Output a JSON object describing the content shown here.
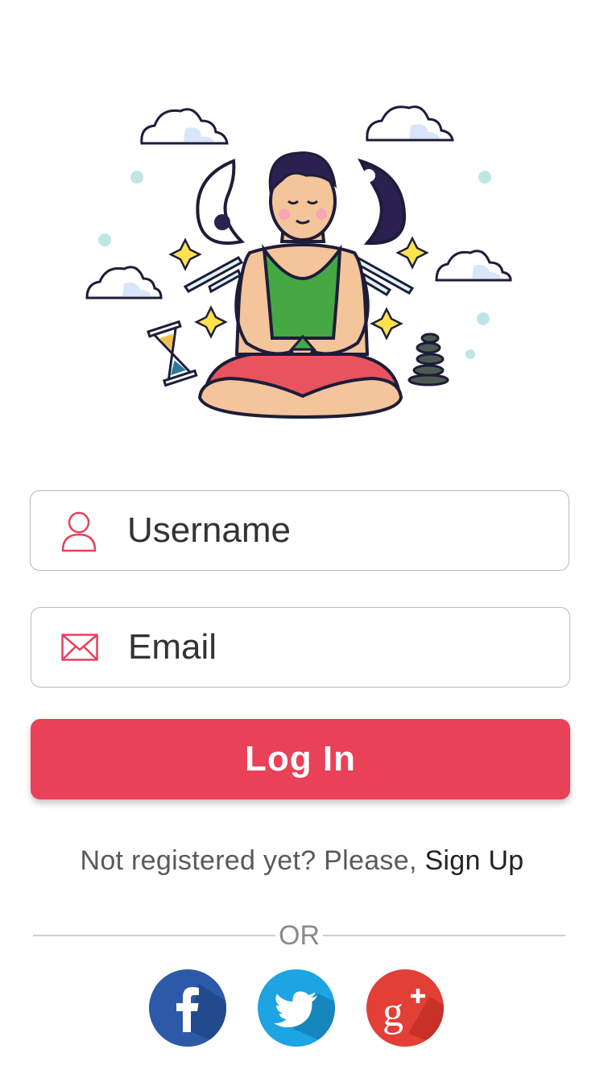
{
  "hero": {
    "illustration": "meditating-man-illustration"
  },
  "form": {
    "username": {
      "placeholder": "Username",
      "icon": "user-icon"
    },
    "email": {
      "placeholder": "Email",
      "icon": "envelope-icon"
    },
    "login_label": "Log In"
  },
  "signup": {
    "prompt": "Not registered yet? Please, ",
    "link": "Sign Up"
  },
  "divider": {
    "label": "OR"
  },
  "social": [
    {
      "name": "facebook",
      "icon": "facebook-icon",
      "color": "#2d5aa8"
    },
    {
      "name": "twitter",
      "icon": "twitter-icon",
      "color": "#1ea3e3"
    },
    {
      "name": "google-plus",
      "icon": "google-plus-icon",
      "color": "#e23f36"
    }
  ],
  "colors": {
    "accent": "#e84158",
    "icon_red": "#e84158",
    "border": "#b9b9b9"
  }
}
